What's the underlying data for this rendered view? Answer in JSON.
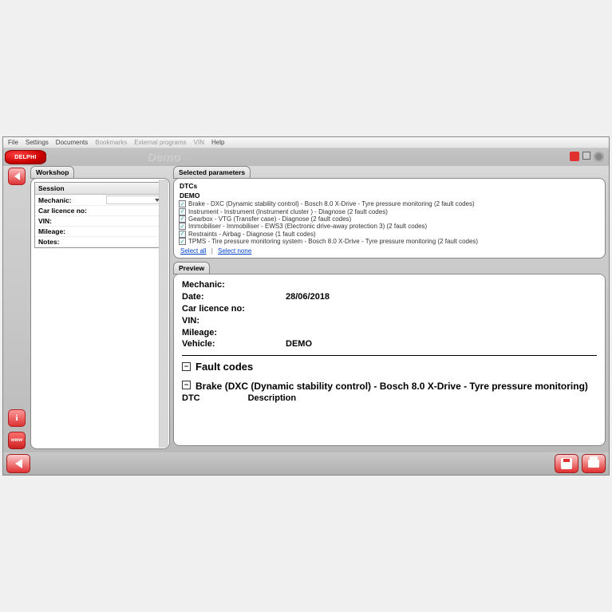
{
  "menubar": {
    "file": "File",
    "settings": "Settings",
    "documents": "Documents",
    "bookmarks": "Bookmarks",
    "external": "External programs",
    "vin": "VIN",
    "help": "Help"
  },
  "brand": "DELPHI",
  "demo_label": "Demo",
  "left_panel": {
    "tab": "Workshop",
    "session_header": "Session",
    "fields": {
      "mechanic": "Mechanic:",
      "car_licence": "Car licence no:",
      "vin": "VIN:",
      "mileage": "Mileage:",
      "notes": "Notes:"
    }
  },
  "selected_params": {
    "tab": "Selected parameters",
    "dtcs_label": "DTCs",
    "group": "DEMO",
    "items": [
      "Brake - DXC (Dynamic stability control) - Bosch 8.0 X-Drive - Tyre pressure monitoring (2 fault codes)",
      "Instrument - Instrument (Instrument cluster ) - Diagnose (2 fault codes)",
      "Gearbox - VTG (Transfer case) - Diagnose (2 fault codes)",
      "Immobiliser - Immobiliser - EWS3 (Electronic drive-away protection 3) (2 fault codes)",
      "Restraints - Airbag - Diagnose (1 fault codes)",
      "TPMS - Tire pressure monitoring system - Bosch 8.0 X-Drive - Tyre pressure monitoring (2 fault codes)"
    ],
    "select_all": "Select all",
    "select_none": "Select none"
  },
  "preview": {
    "tab": "Preview",
    "labels": {
      "mechanic": "Mechanic:",
      "date": "Date:",
      "car_licence": "Car licence no:",
      "vin": "VIN:",
      "mileage": "Mileage:",
      "vehicle": "Vehicle:"
    },
    "values": {
      "mechanic": "",
      "date": "28/06/2018",
      "car_licence": "",
      "vin": "",
      "mileage": "",
      "vehicle": "DEMO"
    },
    "fault_codes_header": "Fault codes",
    "section1": "Brake (DXC (Dynamic stability control) - Bosch 8.0 X-Drive - Tyre pressure monitoring)",
    "col_dtc": "DTC",
    "col_desc": "Description"
  }
}
